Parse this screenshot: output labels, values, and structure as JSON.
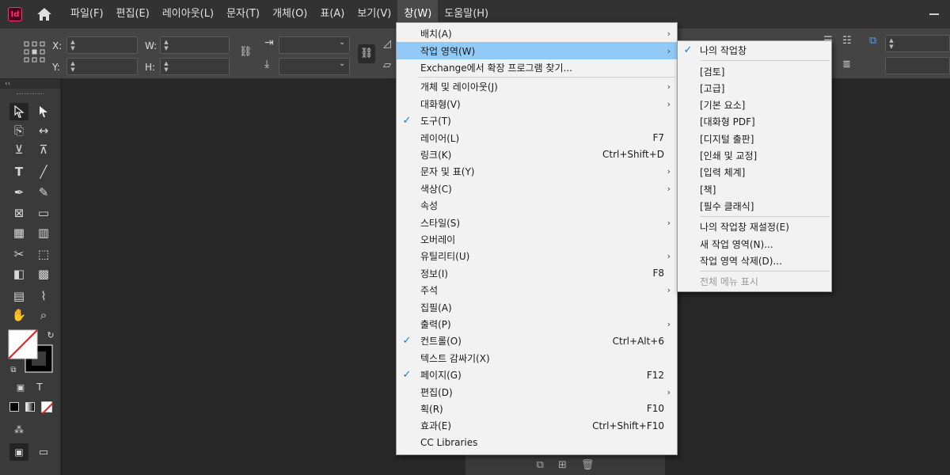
{
  "app": {
    "logo_text": "Id",
    "logo_color": "#ff3366"
  },
  "menubar": {
    "items": [
      "파일(F)",
      "편집(E)",
      "레이아웃(L)",
      "문자(T)",
      "개체(O)",
      "표(A)",
      "보기(V)",
      "창(W)",
      "도움말(H)"
    ],
    "active": "창(W)"
  },
  "control_panel": {
    "x_label": "X:",
    "y_label": "Y:",
    "w_label": "W:",
    "h_label": "H:"
  },
  "tools_panel": {
    "collapse_label": "‹‹"
  },
  "window_menu": {
    "items": [
      {
        "label": "배치(A)",
        "shortcut": "",
        "checked": false,
        "submenu": true
      },
      {
        "label": "작업 영역(W)",
        "shortcut": "",
        "checked": false,
        "submenu": true,
        "highlighted": true
      },
      {
        "label": "Exchange에서 확장 프로그램 찾기...",
        "shortcut": "",
        "checked": false,
        "submenu": false
      },
      {
        "label": "개체 및 레이아웃(J)",
        "shortcut": "",
        "checked": false,
        "submenu": true
      },
      {
        "label": "대화형(V)",
        "shortcut": "",
        "checked": false,
        "submenu": true
      },
      {
        "label": "도구(T)",
        "shortcut": "",
        "checked": true,
        "submenu": false
      },
      {
        "label": "레이어(L)",
        "shortcut": "F7",
        "checked": false,
        "submenu": false
      },
      {
        "label": "링크(K)",
        "shortcut": "Ctrl+Shift+D",
        "checked": false,
        "submenu": false
      },
      {
        "label": "문자 및 표(Y)",
        "shortcut": "",
        "checked": false,
        "submenu": true
      },
      {
        "label": "색상(C)",
        "shortcut": "",
        "checked": false,
        "submenu": true
      },
      {
        "label": "속성",
        "shortcut": "",
        "checked": false,
        "submenu": false
      },
      {
        "label": "스타일(S)",
        "shortcut": "",
        "checked": false,
        "submenu": true
      },
      {
        "label": "오버레이",
        "shortcut": "",
        "checked": false,
        "submenu": false
      },
      {
        "label": "유틸리티(U)",
        "shortcut": "",
        "checked": false,
        "submenu": true
      },
      {
        "label": "정보(I)",
        "shortcut": "F8",
        "checked": false,
        "submenu": false
      },
      {
        "label": "주석",
        "shortcut": "",
        "checked": false,
        "submenu": true
      },
      {
        "label": "집필(A)",
        "shortcut": "",
        "checked": false,
        "submenu": false
      },
      {
        "label": "출력(P)",
        "shortcut": "",
        "checked": false,
        "submenu": true
      },
      {
        "label": "컨트롤(O)",
        "shortcut": "Ctrl+Alt+6",
        "checked": true,
        "submenu": false
      },
      {
        "label": "텍스트 감싸기(X)",
        "shortcut": "",
        "checked": false,
        "submenu": false
      },
      {
        "label": "페이지(G)",
        "shortcut": "F12",
        "checked": true,
        "submenu": false
      },
      {
        "label": "편집(D)",
        "shortcut": "",
        "checked": false,
        "submenu": true
      },
      {
        "label": "획(R)",
        "shortcut": "F10",
        "checked": false,
        "submenu": false
      },
      {
        "label": "효과(E)",
        "shortcut": "Ctrl+Shift+F10",
        "checked": false,
        "submenu": false
      },
      {
        "label": "CC Libraries",
        "shortcut": "",
        "checked": false,
        "submenu": false
      }
    ]
  },
  "workspace_submenu": {
    "items": [
      {
        "label": "나의 작업창",
        "checked": true,
        "disabled": false
      },
      {
        "label": "[검토]",
        "checked": false,
        "disabled": false
      },
      {
        "label": "[고급]",
        "checked": false,
        "disabled": false
      },
      {
        "label": "[기본 요소]",
        "checked": false,
        "disabled": false
      },
      {
        "label": "[대화형 PDF]",
        "checked": false,
        "disabled": false
      },
      {
        "label": "[디지털 출판]",
        "checked": false,
        "disabled": false
      },
      {
        "label": "[인쇄 및 교정]",
        "checked": false,
        "disabled": false
      },
      {
        "label": "[입력 체계]",
        "checked": false,
        "disabled": false
      },
      {
        "label": "[책]",
        "checked": false,
        "disabled": false
      },
      {
        "label": "[필수 클래식]",
        "checked": false,
        "disabled": false
      },
      {
        "label": "나의 작업창 재설정(E)",
        "checked": false,
        "disabled": false
      },
      {
        "label": "새 작업 영역(N)...",
        "checked": false,
        "disabled": false
      },
      {
        "label": "작업 영역 삭제(D)...",
        "checked": false,
        "disabled": false
      },
      {
        "label": "전체 메뉴 표시",
        "checked": false,
        "disabled": true
      }
    ]
  },
  "colors": {
    "highlight": "#91c9f7",
    "check": "#1a79d4",
    "menu_bg": "#f2f2f2"
  }
}
